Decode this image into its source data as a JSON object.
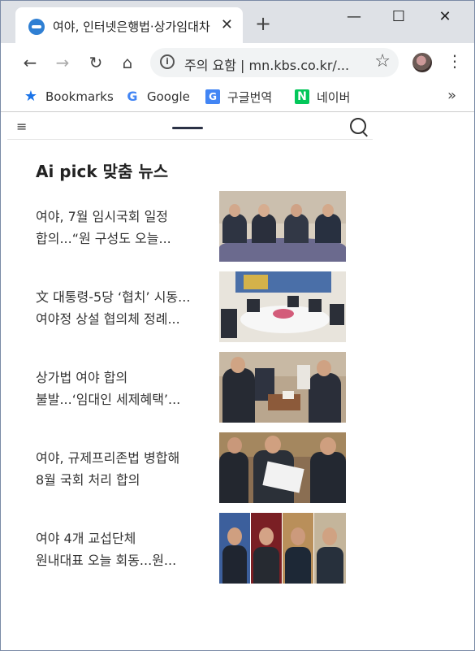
{
  "browser": {
    "tab_title": "여야, 인터넷은행법·상가임대차",
    "tab_close": "✕",
    "new_tab": "+",
    "window_controls": {
      "minimize": "—",
      "maximize": "☐",
      "close": "✕"
    },
    "nav": {
      "back": "←",
      "forward": "→",
      "reload": "↻",
      "home": "⌂"
    },
    "address": {
      "security_label": "주의 요함",
      "url": "mn.kbs.co.kr/..."
    },
    "bookmarks": [
      {
        "label": "Bookmarks",
        "icon": "star-icon"
      },
      {
        "label": "Google",
        "icon": "google-icon"
      },
      {
        "label": "구글번역",
        "icon": "translate-icon"
      },
      {
        "label": "네이버",
        "icon": "naver-icon"
      }
    ],
    "bookmarks_more": "»"
  },
  "page": {
    "section_title": "Ai pick 맞춤 뉴스",
    "news": [
      {
        "title": "여야, 7월 임시국회 일정\n합의...“원 구성도 오늘...",
        "thumb": "four-men-at-table"
      },
      {
        "title": "文 대통령-5당 ‘협치’ 시동...\n여야정 상설 협의체 정례...",
        "thumb": "round-table-meeting"
      },
      {
        "title": "상가법 여야 합의\n불발...‘임대인 세제혜택’...",
        "thumb": "sofa-meeting"
      },
      {
        "title": "여야, 규제프리존법 병합해\n8월 국회 처리 합의",
        "thumb": "press-briefing"
      },
      {
        "title": "여야 4개 교섭단체\n원내대표 오늘 회동...원...",
        "thumb": "four-portraits"
      }
    ]
  },
  "colors": {
    "accent_blue": "#1a73e8",
    "naver_green": "#03c75a",
    "logo_bar": "#2b3246"
  }
}
